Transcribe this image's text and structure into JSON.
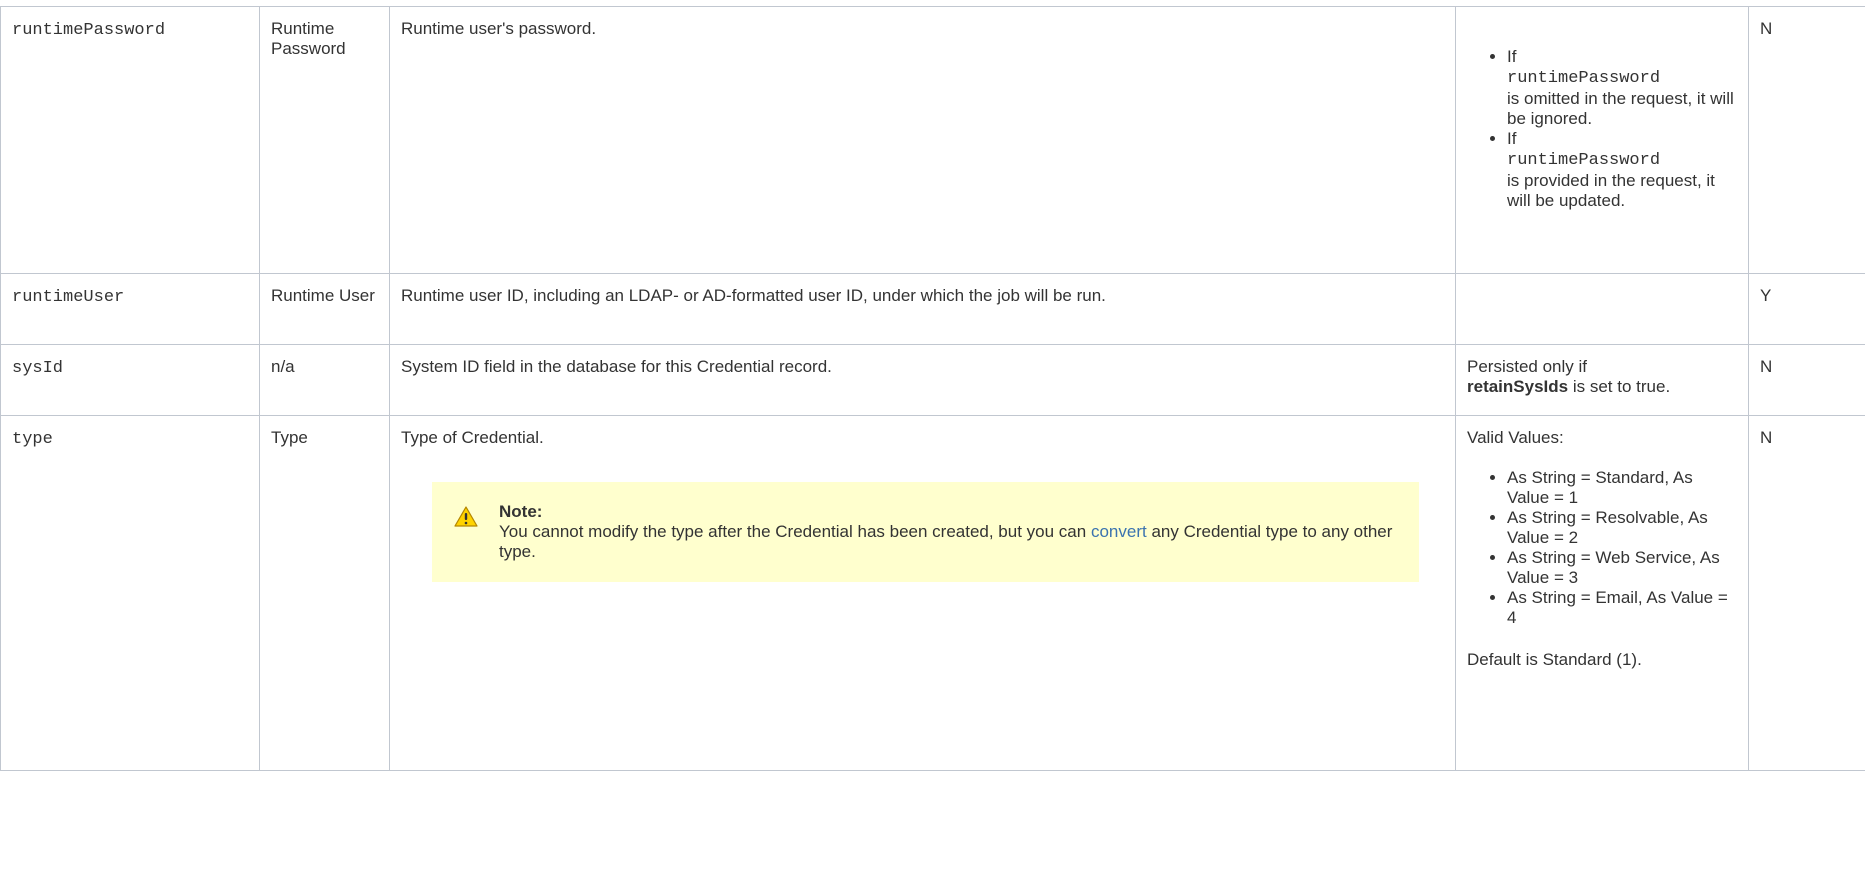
{
  "rows": [
    {
      "name": "runtimePassword",
      "ui_field": "Runtime Password",
      "description": "Runtime user's password.",
      "specs": {
        "bullets": [
          {
            "pre": "If",
            "code": "runtimePassword",
            "post": "is omitted in the request, it will be ignored."
          },
          {
            "pre": "If",
            "code": "runtimePassword",
            "post": "is provided in the request, it will be updated."
          }
        ]
      },
      "required": "N"
    },
    {
      "name": "runtimeUser",
      "ui_field": "Runtime User",
      "description": "Runtime user ID, including an LDAP- or AD-formatted user ID, under which the job will be run.",
      "specs": "",
      "required": "Y"
    },
    {
      "name": "sysId",
      "ui_field": "n/a",
      "description": "System ID field in the database for this Credential record.",
      "specs": {
        "pre": "Persisted only if",
        "bold": "retainSysIds",
        "post": "is set to true."
      },
      "required": "N"
    },
    {
      "name": "type",
      "ui_field": "Type",
      "description": "Type of Credential.",
      "note": {
        "icon": "warning-icon",
        "title": "Note:",
        "text_before": "You cannot modify the type after the Credential has been created, but you can",
        "link": "convert",
        "text_after": "any Credential type to any other type."
      },
      "specs": {
        "intro": "Valid Values:",
        "values": [
          "As String = Standard, As Value = 1",
          "As String = Resolvable, As Value = 2",
          "As String = Web Service, As Value = 3",
          "As String = Email, As Value = 4"
        ],
        "default": "Default is Standard (1)."
      },
      "required": "N"
    }
  ]
}
